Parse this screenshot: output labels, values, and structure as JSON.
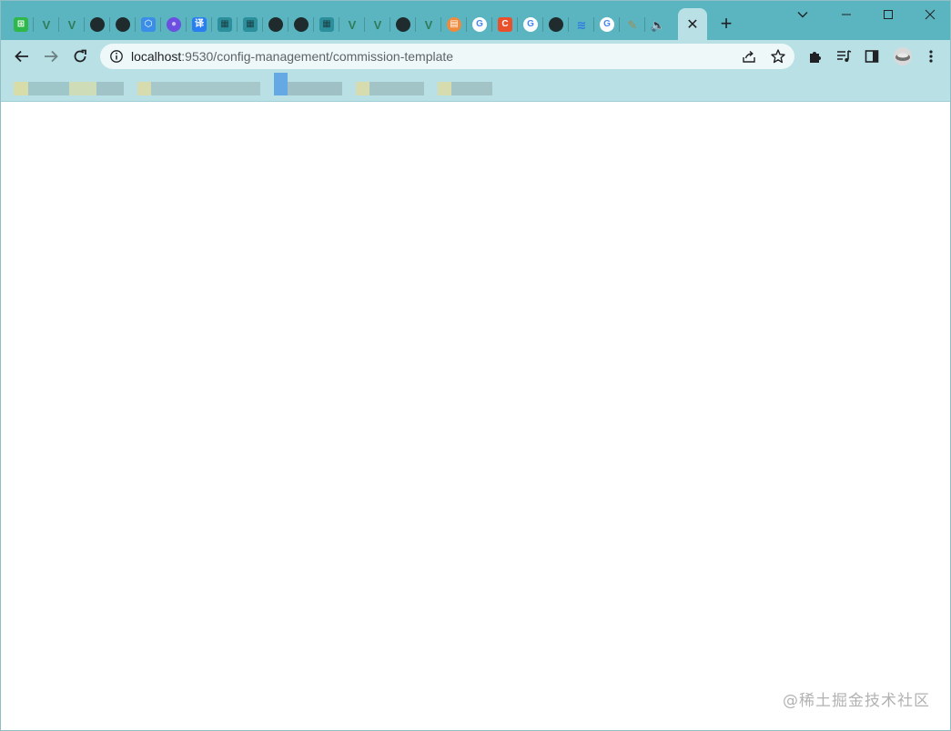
{
  "browser": {
    "active_tab_close": "✕",
    "new_tab": "+",
    "tabs": [
      {
        "icon": "green-grid-icon",
        "glyph": "⊞",
        "bg": "#2fb84a",
        "fg": "#ffffff",
        "shape": "sq"
      },
      {
        "icon": "vue-logo-icon",
        "glyph": "V",
        "bg": "transparent",
        "fg": "#2f7d5a",
        "shape": "sq"
      },
      {
        "icon": "vue-logo-icon",
        "glyph": "V",
        "bg": "transparent",
        "fg": "#2f7d5a",
        "shape": "sq"
      },
      {
        "icon": "globe-icon",
        "glyph": "●",
        "bg": "#1f2b2d",
        "fg": "#1f2b2d",
        "shape": "circle"
      },
      {
        "icon": "globe-icon",
        "glyph": "●",
        "bg": "#1f2b2d",
        "fg": "#1f2b2d",
        "shape": "circle"
      },
      {
        "icon": "hexagon-logo-icon",
        "glyph": "⬡",
        "bg": "#3a8ee8",
        "fg": "#ffffff",
        "shape": "sq"
      },
      {
        "icon": "purple-circle-icon",
        "glyph": "●",
        "bg": "#6c4ee0",
        "fg": "#c9bdf5",
        "shape": "circle"
      },
      {
        "icon": "translate-icon",
        "glyph": "译",
        "bg": "#2a7ff0",
        "fg": "#ffffff",
        "shape": "sq"
      },
      {
        "icon": "studio-icon",
        "glyph": "▦",
        "bg": "#2c8f9c",
        "fg": "#1a3f44",
        "shape": "sq"
      },
      {
        "icon": "studio-icon",
        "glyph": "▦",
        "bg": "#2c8f9c",
        "fg": "#1a3f44",
        "shape": "sq"
      },
      {
        "icon": "github-icon",
        "glyph": "●",
        "bg": "#1f2b2d",
        "fg": "#1f2b2d",
        "shape": "circle"
      },
      {
        "icon": "github-icon",
        "glyph": "●",
        "bg": "#1f2b2d",
        "fg": "#1f2b2d",
        "shape": "circle"
      },
      {
        "icon": "studio-icon",
        "glyph": "▦",
        "bg": "#2c8f9c",
        "fg": "#1a3f44",
        "shape": "sq"
      },
      {
        "icon": "vue-logo-icon",
        "glyph": "V",
        "bg": "transparent",
        "fg": "#2f7d5a",
        "shape": "sq"
      },
      {
        "icon": "vue-logo-icon",
        "glyph": "V",
        "bg": "transparent",
        "fg": "#2f7d5a",
        "shape": "sq"
      },
      {
        "icon": "github-icon",
        "glyph": "●",
        "bg": "#1f2b2d",
        "fg": "#1f2b2d",
        "shape": "circle"
      },
      {
        "icon": "vue-logo-icon",
        "glyph": "V",
        "bg": "transparent",
        "fg": "#2f7d5a",
        "shape": "sq"
      },
      {
        "icon": "orange-doc-icon",
        "glyph": "▤",
        "bg": "#f08a3c",
        "fg": "#ffffff",
        "shape": "circle"
      },
      {
        "icon": "google-icon",
        "glyph": "G",
        "bg": "#ffffff",
        "fg": "#4285f4",
        "shape": "circle"
      },
      {
        "icon": "csdn-icon",
        "glyph": "C",
        "bg": "#e9512c",
        "fg": "#ffffff",
        "shape": "sq"
      },
      {
        "icon": "google-icon",
        "glyph": "G",
        "bg": "#ffffff",
        "fg": "#4285f4",
        "shape": "circle"
      },
      {
        "icon": "github-icon",
        "glyph": "●",
        "bg": "#1f2b2d",
        "fg": "#1f2b2d",
        "shape": "circle"
      },
      {
        "icon": "layers-icon",
        "glyph": "≋",
        "bg": "transparent",
        "fg": "#2f7de0",
        "shape": "sq"
      },
      {
        "icon": "google-icon",
        "glyph": "G",
        "bg": "#ffffff",
        "fg": "#4285f4",
        "shape": "circle"
      },
      {
        "icon": "pencil-icon",
        "glyph": "✎",
        "bg": "transparent",
        "fg": "#a78a4c",
        "shape": "sq"
      },
      {
        "icon": "speaker-icon",
        "glyph": "🔈",
        "bg": "transparent",
        "fg": "#202124",
        "shape": "sq"
      }
    ]
  },
  "address_bar": {
    "host": "localhost",
    "rest": ":9530/config-management/commission-template"
  },
  "watermark": "@稀土掘金技术社区"
}
